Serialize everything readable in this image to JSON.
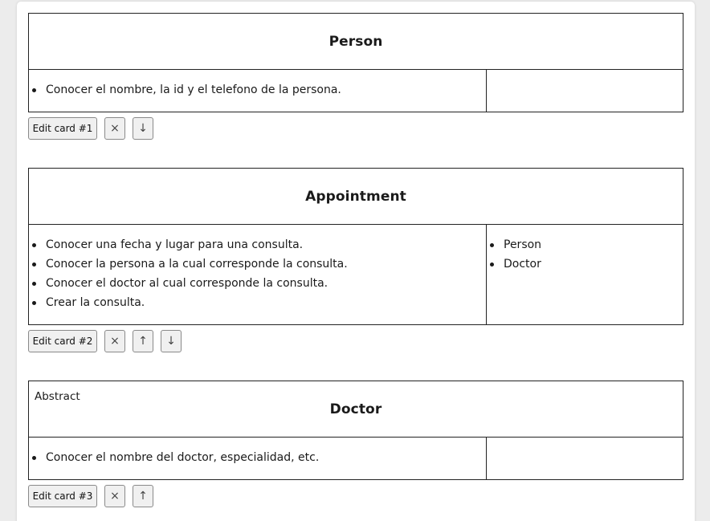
{
  "cards": [
    {
      "tag": "",
      "title": "Person",
      "responsibilities": [
        "Conocer el nombre, la id y el telefono de la persona."
      ],
      "collaborators": [],
      "edit_label": "Edit card #1",
      "delete_glyph": "×",
      "up_glyph": "",
      "down_glyph": "↓"
    },
    {
      "tag": "",
      "title": "Appointment",
      "responsibilities": [
        "Conocer una fecha y lugar para una consulta.",
        "Conocer la persona a la cual corresponde la consulta.",
        "Conocer el doctor al cual corresponde la consulta.",
        "Crear la consulta."
      ],
      "collaborators": [
        "Person",
        "Doctor"
      ],
      "edit_label": "Edit card #2",
      "delete_glyph": "×",
      "up_glyph": "↑",
      "down_glyph": "↓"
    },
    {
      "tag": "Abstract",
      "title": "Doctor",
      "responsibilities": [
        "Conocer el nombre del doctor, especialidad, etc."
      ],
      "collaborators": [],
      "edit_label": "Edit card #3",
      "delete_glyph": "×",
      "up_glyph": "↑",
      "down_glyph": ""
    }
  ]
}
